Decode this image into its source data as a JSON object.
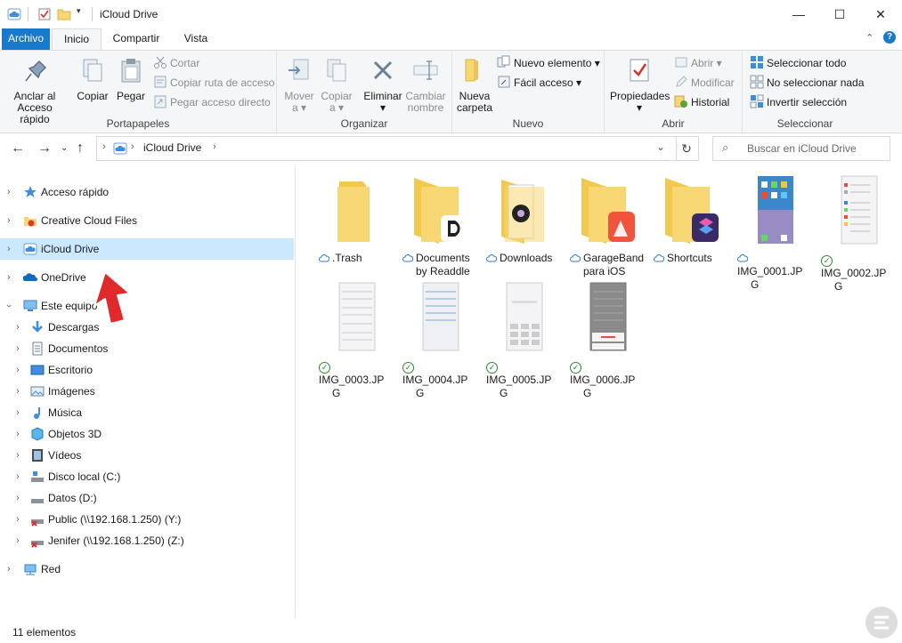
{
  "window": {
    "title": "iCloud Drive",
    "controls": {
      "minimize": "—",
      "maximize": "☐",
      "close": "✕"
    }
  },
  "ribbon_tabs": {
    "archivo": "Archivo",
    "inicio": "Inicio",
    "compartir": "Compartir",
    "vista": "Vista"
  },
  "ribbon": {
    "portapapeles": {
      "label": "Portapapeles",
      "anclar": "Anclar al Acceso rápido",
      "copiar": "Copiar",
      "pegar": "Pegar",
      "cortar": "Cortar",
      "copiar_ruta": "Copiar ruta de acceso",
      "pegar_acceso": "Pegar acceso directo"
    },
    "organizar": {
      "label": "Organizar",
      "mover": "Mover",
      "mover_sub": "a",
      "copiar": "Copiar",
      "copiar_sub": "a",
      "eliminar": "Eliminar",
      "cambiar": "Cambiar",
      "cambiar_sub": "nombre"
    },
    "nuevo": {
      "label": "Nuevo",
      "nueva": "Nueva",
      "nueva_sub": "carpeta",
      "nuevo_elemento": "Nuevo elemento",
      "facil_acceso": "Fácil acceso"
    },
    "abrir": {
      "label": "Abrir",
      "propiedades": "Propiedades",
      "abrir": "Abrir",
      "modificar": "Modificar",
      "historial": "Historial"
    },
    "seleccionar": {
      "label": "Seleccionar",
      "todo": "Seleccionar todo",
      "ninguno": "No seleccionar nada",
      "invertir": "Invertir selección"
    }
  },
  "address": {
    "location": "iCloud Drive",
    "search_placeholder": "Buscar en iCloud Drive"
  },
  "nav": [
    {
      "label": "Acceso rápido",
      "icon": "star-icon"
    },
    {
      "label": "Creative Cloud Files",
      "icon": "creative-cloud-icon"
    },
    {
      "label": "iCloud Drive",
      "icon": "icloud-icon",
      "selected": true
    },
    {
      "label": "OneDrive",
      "icon": "onedrive-icon"
    },
    {
      "label": "Este equipo",
      "icon": "computer-icon",
      "expanded": true
    },
    {
      "label": "Descargas",
      "icon": "download-icon"
    },
    {
      "label": "Documentos",
      "icon": "documents-icon"
    },
    {
      "label": "Escritorio",
      "icon": "desktop-icon"
    },
    {
      "label": "Imágenes",
      "icon": "pictures-icon"
    },
    {
      "label": "Música",
      "icon": "music-icon"
    },
    {
      "label": "Objetos 3D",
      "icon": "3d-objects-icon"
    },
    {
      "label": "Vídeos",
      "icon": "videos-icon"
    },
    {
      "label": "Disco local (C:)",
      "icon": "drive-icon"
    },
    {
      "label": "Datos (D:)",
      "icon": "drive-icon"
    },
    {
      "label": "Public (\\\\192.168.1.250) (Y:)",
      "icon": "network-drive-disconnected-icon"
    },
    {
      "label": "Jenifer (\\\\192.168.1.250) (Z:)",
      "icon": "network-drive-disconnected-icon"
    },
    {
      "label": "Red",
      "icon": "network-icon"
    }
  ],
  "files": [
    {
      "name1": ".Trash",
      "name2": "",
      "status": "cloud",
      "kind": "folder"
    },
    {
      "name1": "Documents",
      "name2": "by Readdle",
      "status": "cloud",
      "kind": "folder-app-documents"
    },
    {
      "name1": "Downloads",
      "name2": "",
      "status": "cloud",
      "kind": "folder-downloads"
    },
    {
      "name1": "GarageBand",
      "name2": "para iOS",
      "status": "cloud",
      "kind": "folder-app-garageband"
    },
    {
      "name1": "Shortcuts",
      "name2": "",
      "status": "cloud",
      "kind": "folder-app-shortcuts"
    },
    {
      "name1": "IMG_0001.JP",
      "name2": "G",
      "status": "cloud",
      "kind": "img-home"
    },
    {
      "name1": "IMG_0002.JP",
      "name2": "G",
      "status": "ok",
      "kind": "img-settings"
    },
    {
      "name1": "IMG_0003.JP",
      "name2": "G",
      "status": "ok",
      "kind": "img-settings"
    },
    {
      "name1": "IMG_0004.JP",
      "name2": "G",
      "status": "ok",
      "kind": "img-list"
    },
    {
      "name1": "IMG_0005.JP",
      "name2": "G",
      "status": "ok",
      "kind": "img-keypad"
    },
    {
      "name1": "IMG_0006.JP",
      "name2": "G",
      "status": "ok",
      "kind": "img-dialog"
    }
  ],
  "status_bar": {
    "count": "11 elementos"
  },
  "colors": {
    "accent": "#1979ca",
    "selection": "#cce8ff",
    "folder": "#f7d774",
    "ok": "#2e8b2e",
    "arrow": "#e0292b"
  }
}
